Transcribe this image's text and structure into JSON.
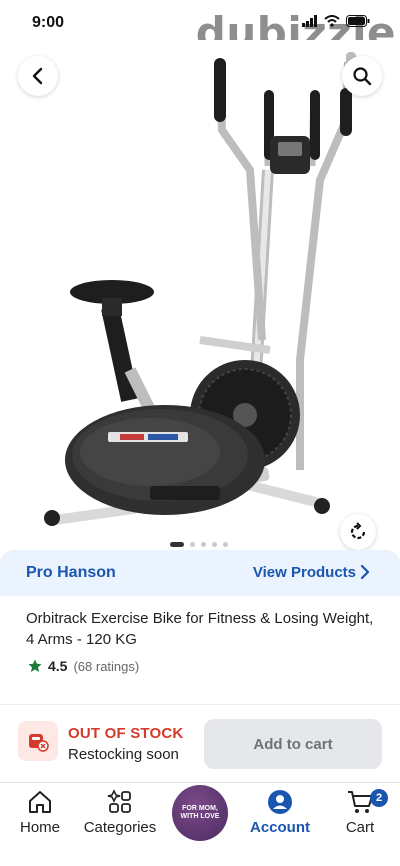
{
  "status_bar": {
    "time": "9:00"
  },
  "watermark": {
    "text": "dubizzle"
  },
  "hero": {
    "carousel": {
      "count": 5,
      "active_index": 0
    },
    "icons": {
      "back": "chevron-left-icon",
      "search": "search-icon",
      "rotate": "rotate-icon"
    }
  },
  "seller": {
    "name": "Pro Hanson",
    "view_products_label": "View Products"
  },
  "product": {
    "title": "Orbitrack Exercise Bike for Fitness & Losing Weight, 4 Arms - 120 KG",
    "rating": "4.5",
    "ratings_count": "(68 ratings)"
  },
  "stock": {
    "status": "OUT OF STOCK",
    "subtitle": "Restocking soon",
    "add_to_cart_label": "Add to cart"
  },
  "bottom_nav": {
    "items": [
      {
        "label": "Home",
        "icon": "home-icon"
      },
      {
        "label": "Categories",
        "icon": "categories-icon"
      },
      {
        "label": "Account",
        "icon": "account-icon",
        "active": true
      },
      {
        "label": "Cart",
        "icon": "cart-icon"
      }
    ],
    "promo_text": "FOR MOM, WITH LOVE",
    "cart_count": "2"
  },
  "colors": {
    "primary_blue": "#1a56b0",
    "out_of_stock_red": "#d23a2a",
    "seller_bar_bg": "#eaf3fe",
    "rating_star": "#1f7a3a"
  }
}
